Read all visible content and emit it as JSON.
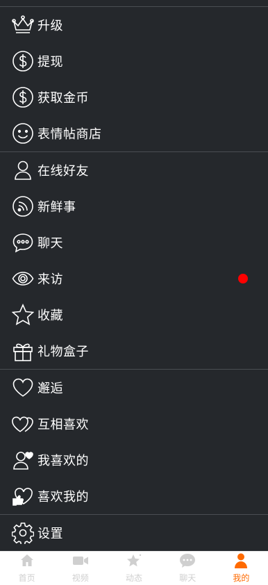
{
  "menu": {
    "group1": [
      {
        "label": "升级",
        "icon": "crown-icon"
      },
      {
        "label": "提现",
        "icon": "dollar-circle-icon"
      },
      {
        "label": "获取金币",
        "icon": "dollar-circle-icon"
      },
      {
        "label": "表情帖商店",
        "icon": "smiley-icon"
      }
    ],
    "group2": [
      {
        "label": "在线好友",
        "icon": "user-icon"
      },
      {
        "label": "新鲜事",
        "icon": "rss-icon"
      },
      {
        "label": "聊天",
        "icon": "chat-bubble-icon"
      },
      {
        "label": "来访",
        "icon": "eye-icon",
        "badge": "red-dot"
      },
      {
        "label": "收藏",
        "icon": "star-icon"
      },
      {
        "label": "礼物盒子",
        "icon": "gift-icon"
      }
    ],
    "group3": [
      {
        "label": "邂逅",
        "icon": "heart-icon"
      },
      {
        "label": "互相喜欢",
        "icon": "double-heart-icon"
      },
      {
        "label": "我喜欢的",
        "icon": "user-heart-icon"
      },
      {
        "label": "喜欢我的",
        "icon": "hand-heart-icon"
      }
    ],
    "group4": [
      {
        "label": "设置",
        "icon": "gear-icon"
      }
    ]
  },
  "tabbar": {
    "tabs": [
      {
        "label": "首页",
        "icon": "home-icon"
      },
      {
        "label": "视频",
        "icon": "video-icon"
      },
      {
        "label": "动态",
        "icon": "star-sparkle-icon"
      },
      {
        "label": "聊天",
        "icon": "chat-icon"
      },
      {
        "label": "我的",
        "icon": "user-icon",
        "active": true
      }
    ]
  },
  "colors": {
    "background": "#25282c",
    "accent": "#ff6a00",
    "badge": "#ff0000",
    "divider": "#4a4e53",
    "inactive_tab": "#cfcfcf"
  }
}
